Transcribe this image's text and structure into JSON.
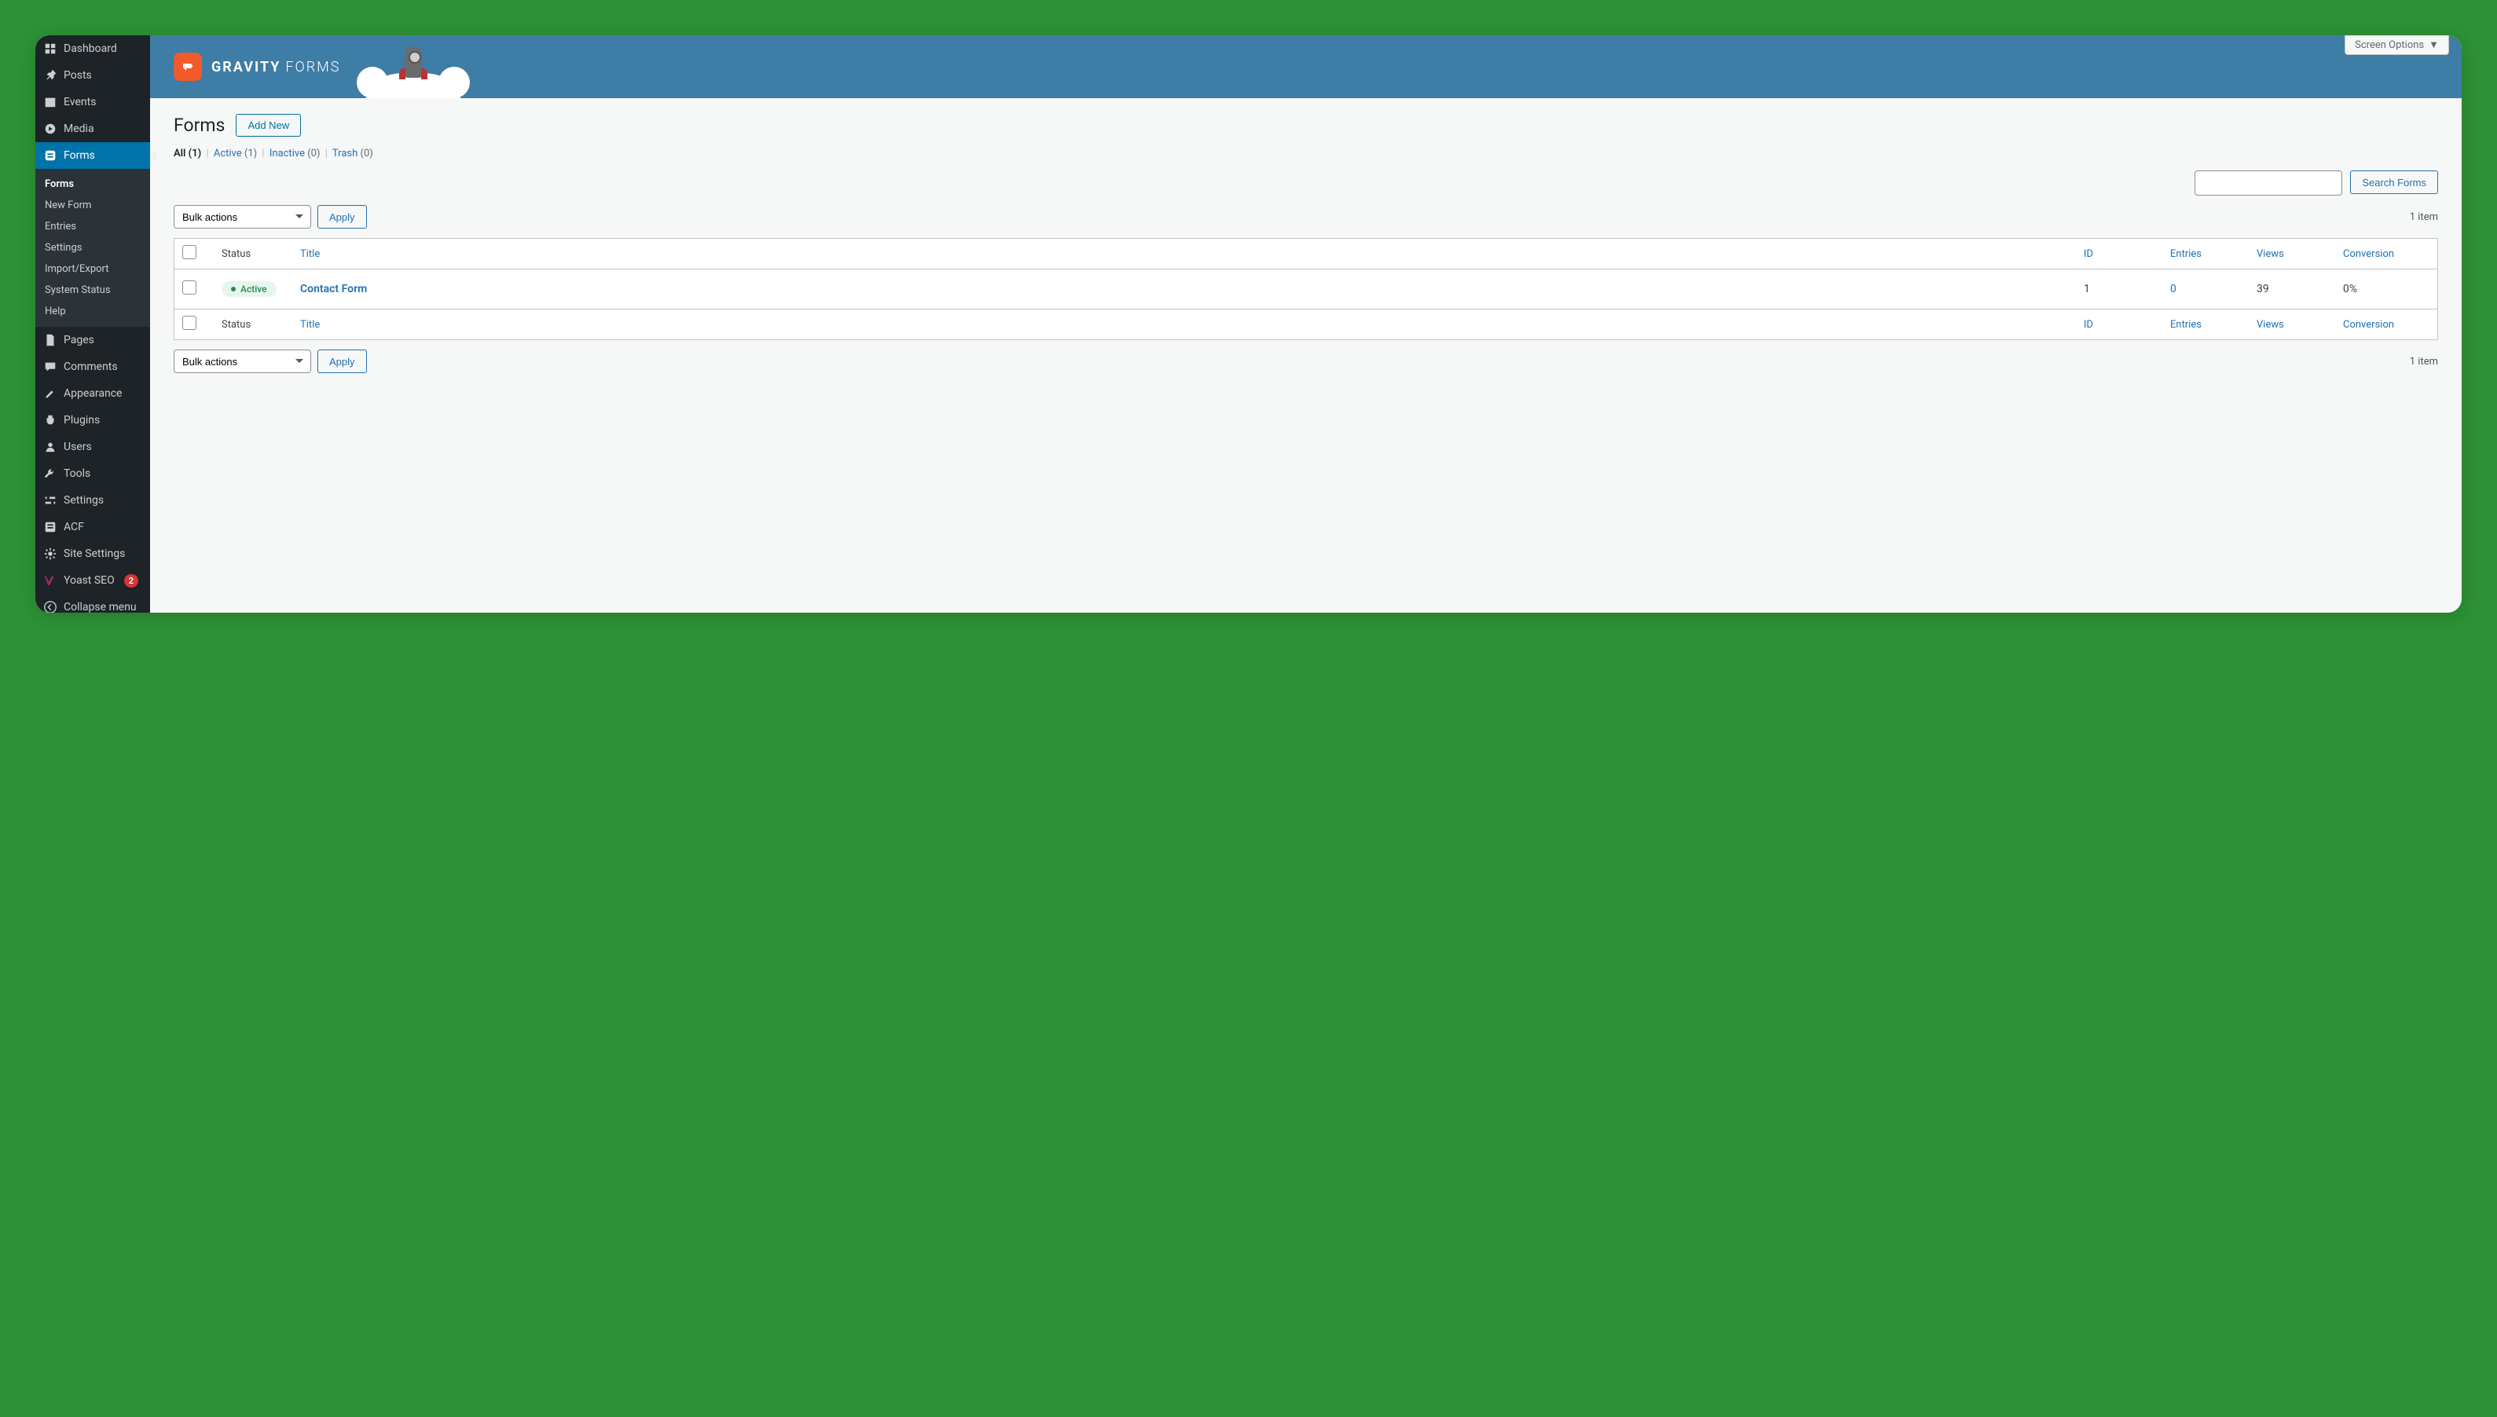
{
  "screen_options_label": "Screen Options",
  "brand": {
    "word1": "GRAVITY",
    "word2": "FORMS"
  },
  "sidebar": {
    "items": [
      {
        "label": "Dashboard",
        "icon": "dashboard"
      },
      {
        "label": "Posts",
        "icon": "pin"
      },
      {
        "label": "Events",
        "icon": "calendar"
      },
      {
        "label": "Media",
        "icon": "media"
      },
      {
        "label": "Forms",
        "icon": "forms",
        "current": true
      },
      {
        "label": "Pages",
        "icon": "pages"
      },
      {
        "label": "Comments",
        "icon": "comments"
      },
      {
        "label": "Appearance",
        "icon": "appearance"
      },
      {
        "label": "Plugins",
        "icon": "plugins"
      },
      {
        "label": "Users",
        "icon": "users"
      },
      {
        "label": "Tools",
        "icon": "tools"
      },
      {
        "label": "Settings",
        "icon": "settings"
      },
      {
        "label": "ACF",
        "icon": "acf"
      },
      {
        "label": "Site Settings",
        "icon": "gear"
      },
      {
        "label": "Yoast SEO",
        "icon": "yoast",
        "badge": "2"
      }
    ],
    "submenu": [
      {
        "label": "Forms",
        "active": true
      },
      {
        "label": "New Form"
      },
      {
        "label": "Entries"
      },
      {
        "label": "Settings"
      },
      {
        "label": "Import/Export"
      },
      {
        "label": "System Status"
      },
      {
        "label": "Help"
      }
    ],
    "collapse_label": "Collapse menu"
  },
  "page": {
    "title": "Forms",
    "add_new": "Add New"
  },
  "filters": {
    "all": {
      "label": "All",
      "count": "(1)"
    },
    "active": {
      "label": "Active",
      "count": "(1)"
    },
    "inactive": {
      "label": "Inactive",
      "count": "(0)"
    },
    "trash": {
      "label": "Trash",
      "count": "(0)"
    }
  },
  "search": {
    "button": "Search Forms"
  },
  "bulk": {
    "placeholder": "Bulk actions",
    "apply_label": "Apply"
  },
  "item_count": "1 item",
  "columns": [
    "Status",
    "Title",
    "ID",
    "Entries",
    "Views",
    "Conversion"
  ],
  "rows": [
    {
      "status": "Active",
      "title": "Contact Form",
      "id": "1",
      "entries": "0",
      "views": "39",
      "conversion": "0%"
    }
  ]
}
